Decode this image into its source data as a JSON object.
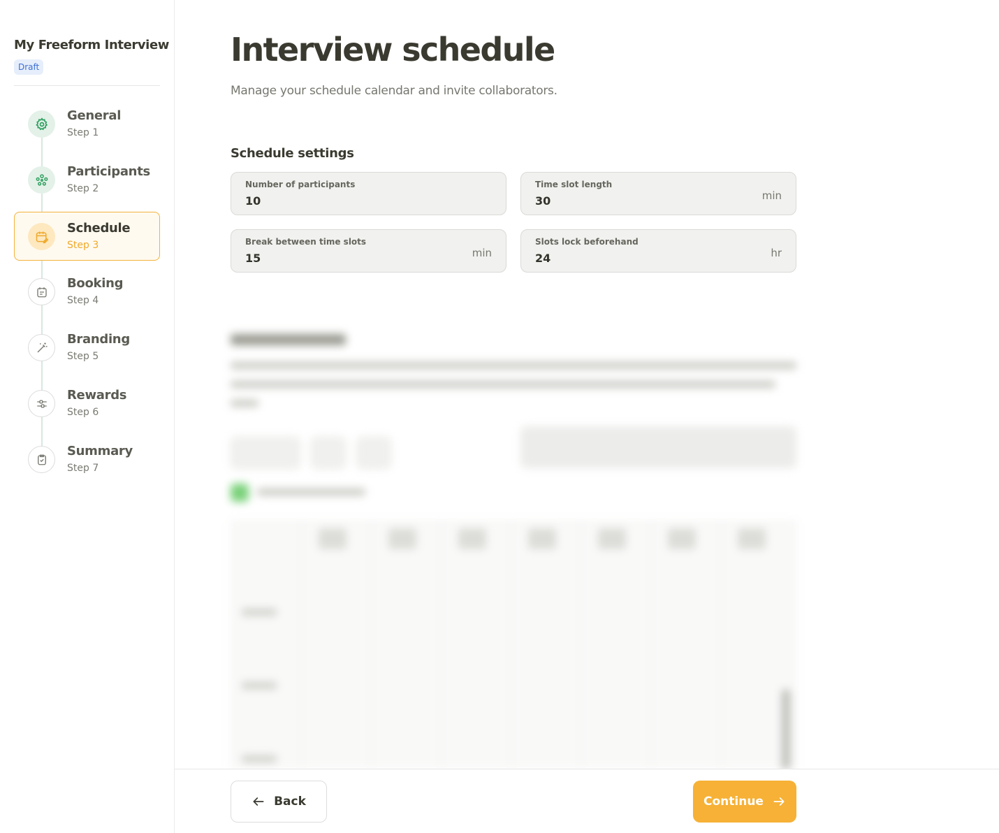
{
  "sidebar": {
    "project_title": "My Freeform Interview",
    "status_badge": "Draft",
    "steps": [
      {
        "title": "General",
        "sub": "Step 1",
        "icon": "gear-icon",
        "state": "done"
      },
      {
        "title": "Participants",
        "sub": "Step 2",
        "icon": "people-icon",
        "state": "done"
      },
      {
        "title": "Schedule",
        "sub": "Step 3",
        "icon": "calendar-edit-icon",
        "state": "current"
      },
      {
        "title": "Booking",
        "sub": "Step 4",
        "icon": "booking-calendar-icon",
        "state": "pending"
      },
      {
        "title": "Branding",
        "sub": "Step 5",
        "icon": "magic-wand-icon",
        "state": "pending"
      },
      {
        "title": "Rewards",
        "sub": "Step 6",
        "icon": "sliders-icon",
        "state": "pending"
      },
      {
        "title": "Summary",
        "sub": "Step 7",
        "icon": "clipboard-check-icon",
        "state": "pending"
      }
    ]
  },
  "main": {
    "title": "Interview schedule",
    "subtitle": "Manage your schedule calendar and invite collaborators.",
    "settings": {
      "section_title": "Schedule settings",
      "fields": [
        {
          "label": "Number of participants",
          "value": "10",
          "unit": ""
        },
        {
          "label": "Time slot length",
          "value": "30",
          "unit": "min"
        },
        {
          "label": "Break between time slots",
          "value": "15",
          "unit": "min"
        },
        {
          "label": "Slots lock beforehand",
          "value": "24",
          "unit": "hr"
        }
      ]
    }
  },
  "footer": {
    "back_label": "Back",
    "continue_label": "Continue"
  },
  "colors": {
    "accent": "#f6b136",
    "done_green": "#2e9e5e",
    "badge_blue": "#3d6fd6"
  }
}
